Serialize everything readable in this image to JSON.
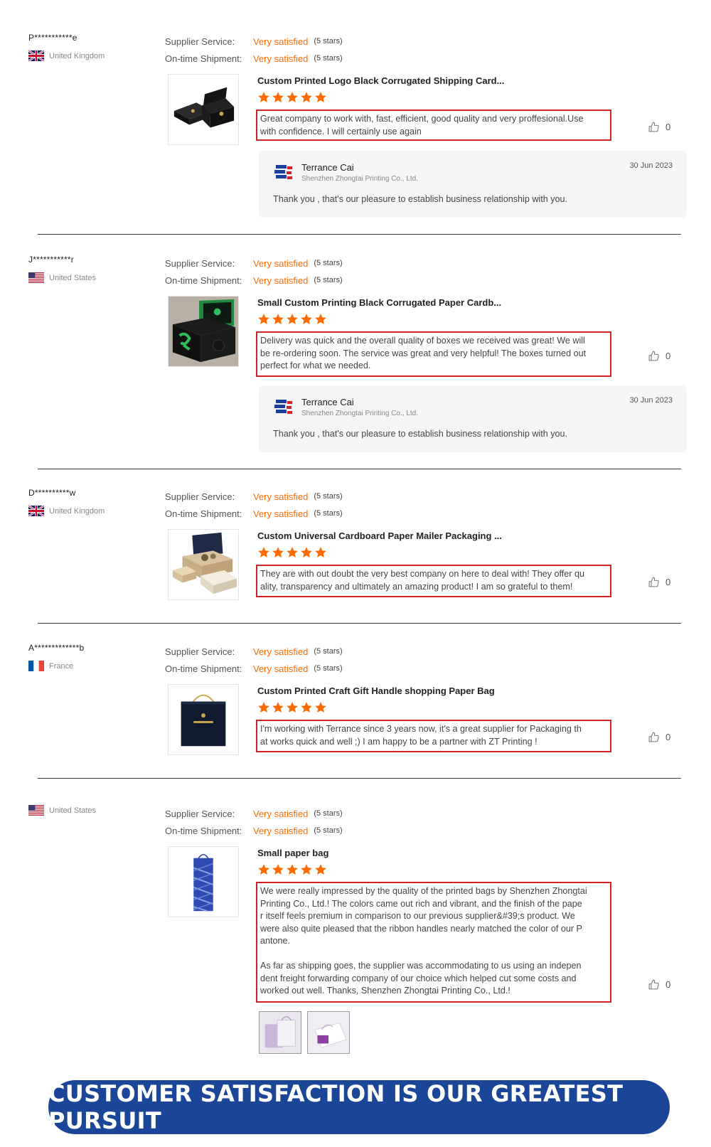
{
  "labels": {
    "supplier_service": "Supplier Service:",
    "ontime_shipment": "On-time Shipment:"
  },
  "reviews": [
    {
      "reviewer": "P***********e",
      "country": "United Kingdom",
      "flag": "uk",
      "supplier_service": "Very satisfied",
      "supplier_stars": "(5 stars)",
      "shipment": "Very satisfied",
      "shipment_stars": "(5 stars)",
      "product": "Custom Printed Logo Black Corrugated Shipping Card...",
      "rating": 5,
      "comment": "Great company to work with, fast, efficient, good quality and very proffesional.Use\nwith confidence. I will certainly use again",
      "likes": "0",
      "reply": {
        "name": "Terrance Cai",
        "company": "Shenzhen Zhongtai Printing Co., Ltd.",
        "date": "30 Jun 2023",
        "text": "Thank you , that's our pleasure to establish business relationship with you."
      }
    },
    {
      "reviewer": "J***********r",
      "country": "United States",
      "flag": "us",
      "supplier_service": "Very satisfied",
      "supplier_stars": "(5 stars)",
      "shipment": "Very satisfied",
      "shipment_stars": "(5 stars)",
      "product": "Small Custom Printing Black Corrugated Paper Cardb...",
      "rating": 5,
      "comment": "Delivery was quick and the overall quality of boxes we received was great! We will\nbe re-ordering soon. The service was great and very helpful! The boxes turned out\nperfect for what we needed.",
      "likes": "0",
      "reply": {
        "name": "Terrance Cai",
        "company": "Shenzhen Zhongtai Printing Co., Ltd.",
        "date": "30 Jun 2023",
        "text": "Thank you , that's our pleasure to establish business relationship with you."
      }
    },
    {
      "reviewer": "D**********w",
      "country": "United Kingdom",
      "flag": "uk",
      "supplier_service": "Very satisfied",
      "supplier_stars": "(5 stars)",
      "shipment": "Very satisfied",
      "shipment_stars": "(5 stars)",
      "product": "Custom Universal Cardboard Paper Mailer Packaging ...",
      "rating": 5,
      "comment": "They are with out doubt the very best company on here to deal with! They offer qu\nality, transparency and ultimately an amazing product! I am so grateful to them!",
      "likes": "0"
    },
    {
      "reviewer": "A*************b",
      "country": "France",
      "flag": "fr",
      "supplier_service": "Very satisfied",
      "supplier_stars": "(5 stars)",
      "shipment": "Very satisfied",
      "shipment_stars": "(5 stars)",
      "product": "Custom Printed Craft Gift Handle shopping Paper Bag",
      "rating": 5,
      "comment": "I'm working with Terrance since 3 years now, it's a great supplier for Packaging th\nat works quick and well ;) I am happy to be a partner with ZT Printing !",
      "likes": "0"
    },
    {
      "reviewer": "",
      "country": "United States",
      "flag": "us",
      "supplier_service": "Very satisfied",
      "supplier_stars": "(5 stars)",
      "shipment": "Very satisfied",
      "shipment_stars": "(5 stars)",
      "product": "Small paper bag",
      "rating": 5,
      "comment": "We were really impressed by the quality of the printed bags by Shenzhen Zhongtai\nPrinting Co., Ltd.!  The colors came out rich and vibrant, and the finish of the pape\nr itself feels premium in comparison to our previous supplier&#39;s product.  We\nwere also quite pleased that the ribbon handles nearly matched the color of our P\nantone.\n\nAs far as shipping goes, the supplier was accommodating to us using an indepen\ndent freight forwarding company of our choice which helped cut some costs and\nworked out well.  Thanks, Shenzhen Zhongtai Printing Co., Ltd.!",
      "likes": "0"
    }
  ],
  "banner": "CUSTOMER SATISFACTION IS OUR GREATEST PURSUIT",
  "colors": {
    "accent_orange": "#ff6a00",
    "highlight_red": "#d32027",
    "banner_blue": "#1b4596"
  }
}
